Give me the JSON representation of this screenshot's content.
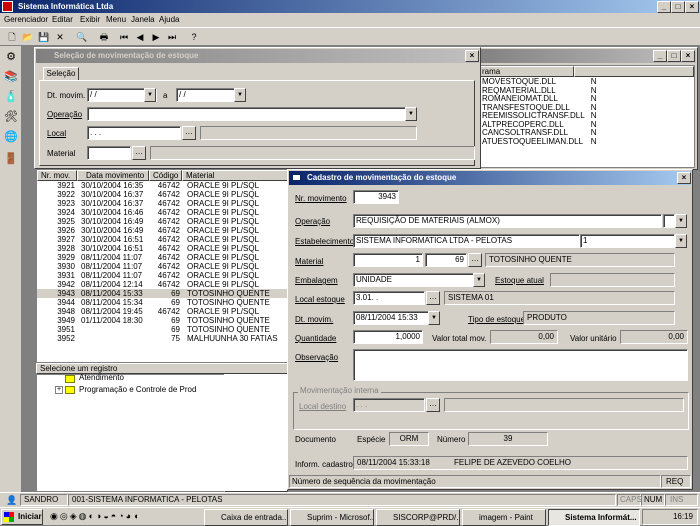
{
  "app": {
    "title": "Sistema Informática Ltda"
  },
  "menu": [
    "Gerenciador",
    "Editar",
    "Exibir",
    "Menu",
    "Janela",
    "Ajuda"
  ],
  "toolbar_icons": [
    "new-icon",
    "open-icon",
    "save-icon",
    "delete-icon",
    "search-icon",
    "print-icon",
    "first-icon",
    "prev-icon",
    "next-icon",
    "last-icon",
    "help-icon"
  ],
  "selecao": {
    "title": "Seleção de movimentação de estoque",
    "tab": "Seleção",
    "dt_label": "Dt. movim.",
    "dt_from": "  /   /",
    "dt_sep": "a",
    "dt_to": "  /   /",
    "operacao_label": "Operação",
    "local_label": "Local",
    "local_value": ". . .",
    "material_label": "Material",
    "grid_headers": [
      "Nr. mov.",
      "Data movimento",
      "Código",
      "Material"
    ],
    "rows": [
      [
        "3921",
        "30/10/2004 16:35",
        "46742",
        "ORACLE 9I PL/SQL"
      ],
      [
        "3922",
        "30/10/2004 16:37",
        "46742",
        "ORACLE 9I PL/SQL"
      ],
      [
        "3923",
        "30/10/2004 16:37",
        "46742",
        "ORACLE 9I PL/SQL"
      ],
      [
        "3924",
        "30/10/2004 16:46",
        "46742",
        "ORACLE 9I PL/SQL"
      ],
      [
        "3925",
        "30/10/2004 16:49",
        "46742",
        "ORACLE 9I PL/SQL"
      ],
      [
        "3926",
        "30/10/2004 16:49",
        "46742",
        "ORACLE 9I PL/SQL"
      ],
      [
        "3927",
        "30/10/2004 16:51",
        "46742",
        "ORACLE 9I PL/SQL"
      ],
      [
        "3928",
        "30/10/2004 16:51",
        "46742",
        "ORACLE 9I PL/SQL"
      ],
      [
        "3929",
        "08/11/2004 11:07",
        "46742",
        "ORACLE 9I PL/SQL"
      ],
      [
        "3930",
        "08/11/2004 11:07",
        "46742",
        "ORACLE 9I PL/SQL"
      ],
      [
        "3931",
        "08/11/2004 11:07",
        "46742",
        "ORACLE 9I PL/SQL"
      ],
      [
        "3942",
        "08/11/2004 12:14",
        "46742",
        "ORACLE 9I PL/SQL"
      ],
      [
        "3943",
        "08/11/2004 15:33",
        "69",
        "TOTOSINHO QUENTE"
      ],
      [
        "3944",
        "08/11/2004 15:34",
        "69",
        "TOTOSINHO QUENTE"
      ],
      [
        "3948",
        "08/11/2004 19:45",
        "46742",
        "ORACLE 9I PL/SQL"
      ],
      [
        "3949",
        "01/11/2004 18:30",
        "69",
        "TOTOSINHO QUENTE"
      ],
      [
        "3951",
        "",
        "69",
        "TOTOSINHO QUENTE"
      ],
      [
        "3952",
        "",
        "75",
        "MALHUUNHA 30 FATIAS"
      ]
    ],
    "selected_row": 12,
    "status": "Selecione um registro"
  },
  "tree": {
    "items": [
      "Atendimento",
      "Programação e Controle de Prod"
    ]
  },
  "dll_panel": {
    "header": "rama",
    "rows": [
      [
        "MOVESTOQUE.DLL",
        "N"
      ],
      [
        "REQMATERIAL.DLL",
        "N"
      ],
      [
        "ROMANEIOMAT.DLL",
        "N"
      ],
      [
        "TRANSFESTOQUE.DLL",
        "N"
      ],
      [
        "REEMISSOLICTRANSF.DLL",
        "N"
      ],
      [
        "ALTPRECOPERC.DLL",
        "N"
      ],
      [
        "CANCSOLTRANSF.DLL",
        "N"
      ],
      [
        "ATUESTOQUEELIMAN.DLL",
        "N"
      ]
    ]
  },
  "cadastro": {
    "title": "Cadastro de movimentação do estoque",
    "nr_mov_label": "Nr. movimento",
    "nr_mov": "3943",
    "operacao_label": "Operação",
    "operacao": "REQUISIÇÃO DE MATERIAIS (ALMOX)",
    "estab_label": "Estabelecimento",
    "estab": "SISTEMA INFORMATICA LTDA - PELOTAS",
    "estab_code": "1",
    "material_label": "Material",
    "material_a": "1",
    "material_b": "69",
    "material_desc": "TOTOSINHO QUENTE",
    "embalagem_label": "Embalagem",
    "embalagem": "UNIDADE",
    "estoque_atual_label": "Estoque atual",
    "local_label": "Local estoque",
    "local": "3.01. .",
    "local_desc": "SISTEMA 01",
    "dt_label": "Dt. movim.",
    "dt": "08/11/2004 15:33",
    "tipo_label": "Tipo de estoque",
    "tipo": "PRODUTO",
    "qtd_label": "Quantidade",
    "qtd": "1,0000",
    "vtotal_label": "Valor total mov.",
    "vtotal": "0,00",
    "vunit_label": "Valor unitário",
    "vunit": "0,00",
    "obs_label": "Observação",
    "mov_interna_label": "Movimentação interna",
    "local_destino_label": "Local destino",
    "local_destino": ". . .",
    "documento_label": "Documento",
    "especie_label": "Espécie",
    "especie": "ORM",
    "numero_label": "Número",
    "numero": "39",
    "inform_label": "Inform. cadastro",
    "inform_date": "08/11/2004 15:33:18",
    "inform_user": "FELIPE DE AZEVEDO COELHO",
    "status": "Número de sequência da movimentação",
    "status_right": "REQ"
  },
  "statusbar": {
    "user": "SANDRO",
    "company": "001-SISTEMA INFORMATICA - PELOTAS",
    "caps": "CAPS",
    "num": "NUM",
    "ins": "INS"
  },
  "taskbar": {
    "start": "Iniciar",
    "tasks": [
      "Caixa de entrada...",
      "Suprim - Microsof...",
      "SISCORP@PRD/...",
      "imagem - Paint",
      "Sistema Informát..."
    ],
    "active_task": 4,
    "clock": "16:19"
  }
}
